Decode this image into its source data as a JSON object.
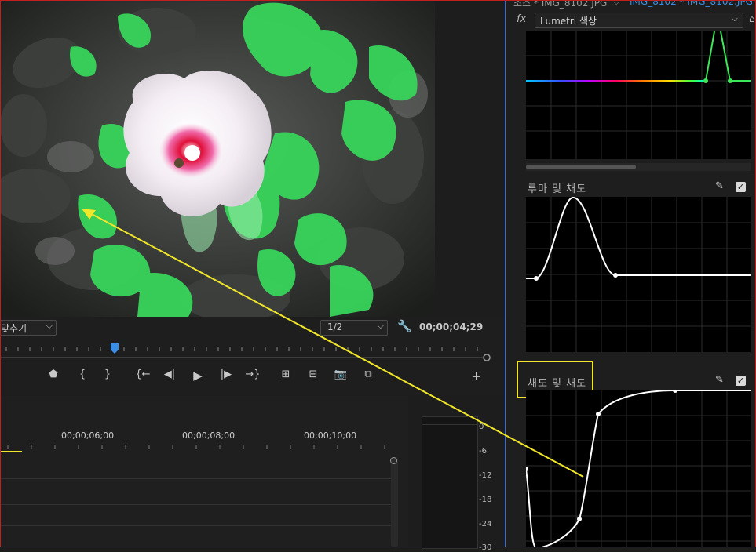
{
  "source_tab": {
    "source_label": "소스 * IMG_8102.JPG",
    "sequence_label": "IMG_8102 * IMG_8102.JPG"
  },
  "effect_header": {
    "fx_label": "fx",
    "effect_name": "Lumetri 색상"
  },
  "monitor": {
    "fit_label": "맞추기",
    "resolution": "1/2",
    "timecode": "00;00;04;29"
  },
  "timeline": {
    "ruler_labels": [
      "00;00;06;00",
      "00;00;08;00",
      "00;00;10;00"
    ]
  },
  "audio_meter": {
    "db_labels": [
      "0",
      "-6",
      "-12",
      "-18",
      "-24",
      "-30"
    ]
  },
  "curves": {
    "luma_vs_sat_label": "루마 및 채도",
    "sat_vs_sat_label": "채도 및 채도"
  },
  "colors": {
    "accent_blue": "#2f6fe0",
    "highlight_yellow": "#f0e62a",
    "border_red": "#c2201d"
  },
  "icons": [
    "fx-icon",
    "eyedropper-icon",
    "checkbox-icon",
    "wrench-icon",
    "play-icon",
    "plus-icon",
    "camera-icon"
  ]
}
